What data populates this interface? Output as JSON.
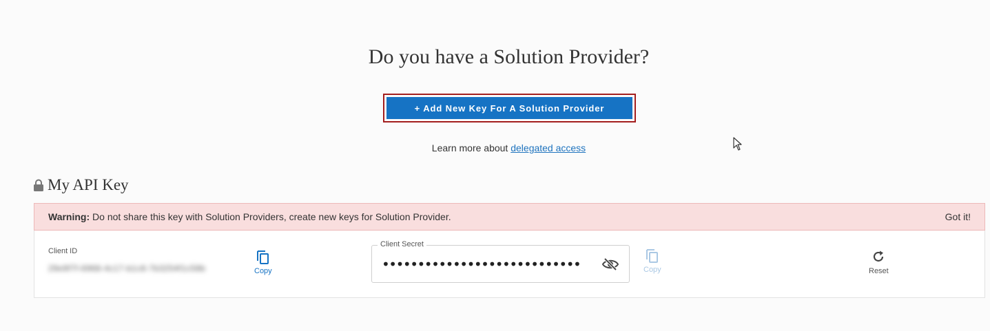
{
  "heading": "Do you have a Solution Provider?",
  "add_key_button": "+ Add New Key For A Solution Provider",
  "learn_more": {
    "prefix": "Learn more about",
    "link": "delegated access"
  },
  "api_key_section": {
    "title": "My API Key",
    "icon": "lock-icon"
  },
  "warning": {
    "label": "Warning:",
    "text": "Do not share this key with Solution Providers, create new keys for Solution Provider.",
    "dismiss": "Got it!"
  },
  "client_id": {
    "label": "Client ID",
    "value": "29e9f7f-6968-4c17-b1c8-7b3254f1c58b",
    "copy_label": "Copy"
  },
  "client_secret": {
    "label": "Client Secret",
    "value": "••••••••••••••••••••••••••••••••••",
    "copy_label": "Copy",
    "visibility_icon": "eye-off-icon"
  },
  "reset": {
    "label": "Reset",
    "icon": "refresh-icon"
  },
  "colors": {
    "primary": "#1673c4",
    "highlight_border": "#a31d1d",
    "warning_bg": "#f9dede"
  }
}
